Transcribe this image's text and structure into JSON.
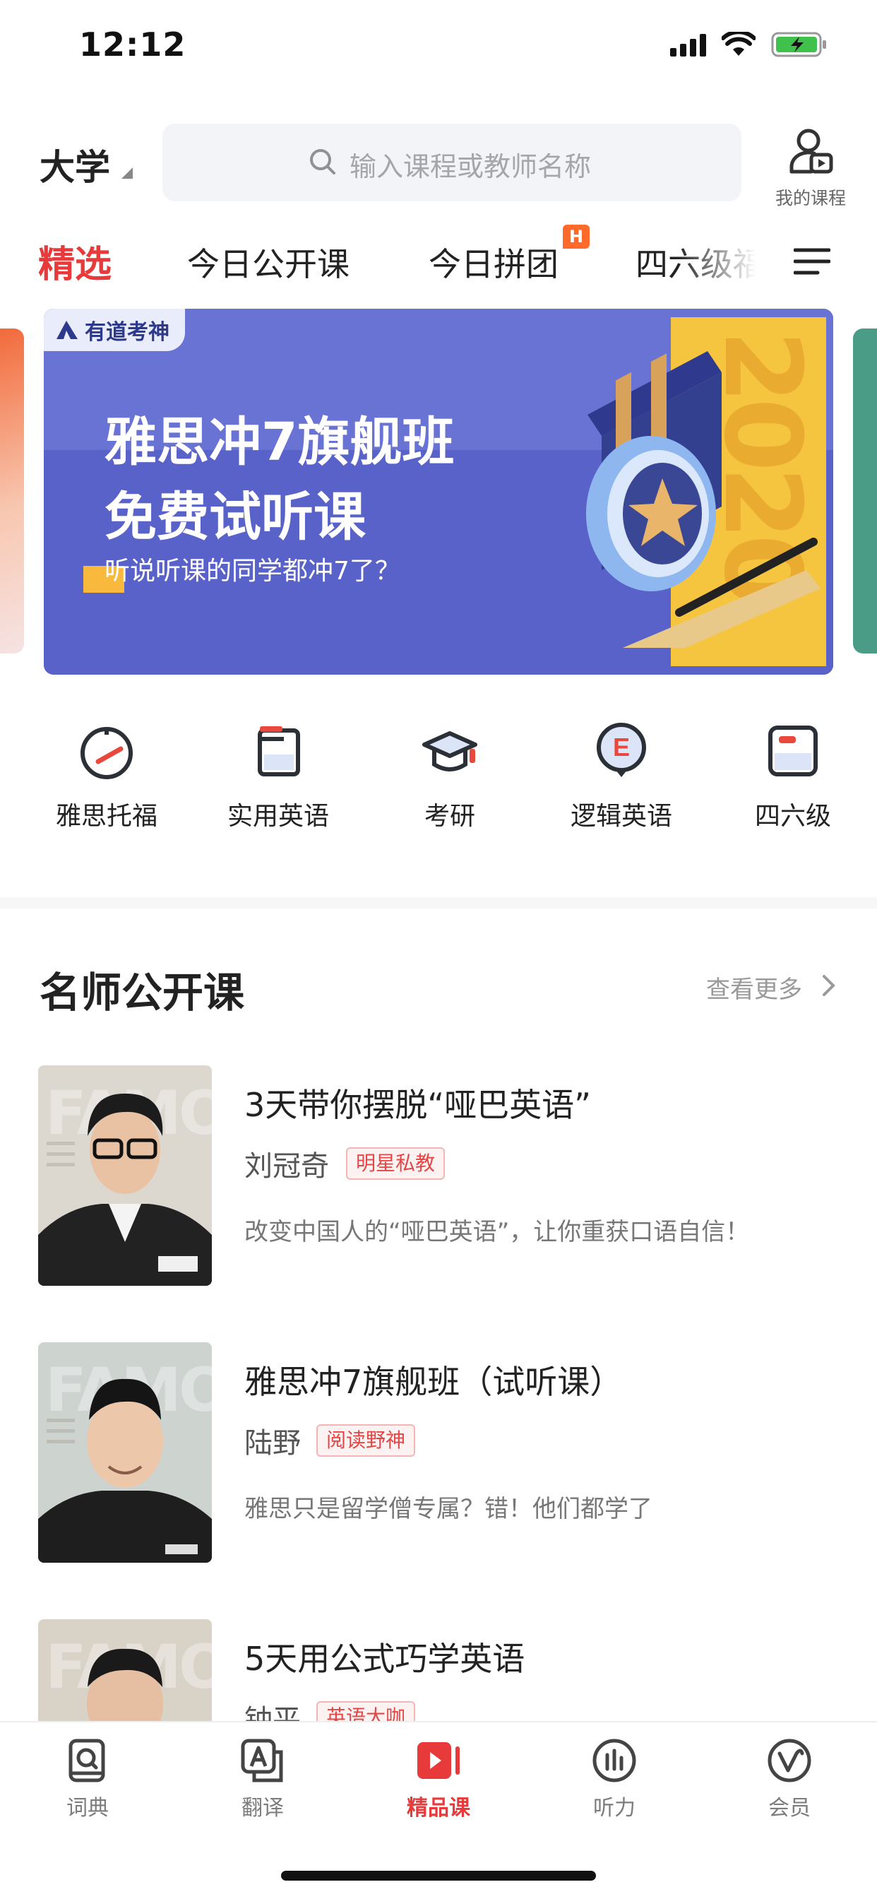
{
  "status_bar": {
    "time": "12:12"
  },
  "header": {
    "grade": "大学",
    "search_placeholder": "输入课程或教师名称",
    "my_courses": "我的课程"
  },
  "tabs": [
    {
      "label": "精选",
      "active": true
    },
    {
      "label": "今日公开课",
      "active": false
    },
    {
      "label": "今日拼团",
      "active": false,
      "badge": "H"
    },
    {
      "label": "四六级福",
      "active": false
    }
  ],
  "banner": {
    "brand": "有道考神",
    "title_line1": "雅思冲7旗舰班",
    "title_line2": "免费试听课",
    "subtitle": "听说听课的同学都冲7了？",
    "year": "2020"
  },
  "categories": [
    {
      "label": "雅思托福",
      "icon": "gauge-icon"
    },
    {
      "label": "实用英语",
      "icon": "book-icon"
    },
    {
      "label": "考研",
      "icon": "graduation-cap-icon"
    },
    {
      "label": "逻辑英语",
      "icon": "e-badge-icon"
    },
    {
      "label": "四六级",
      "icon": "notebook-icon"
    }
  ],
  "section": {
    "title": "名师公开课",
    "more": "查看更多"
  },
  "courses": [
    {
      "title": "3天带你摆脱“哑巴英语”",
      "teacher": "刘冠奇",
      "tag": "明星私教",
      "desc": "改变中国人的“哑巴英语”，让你重获口语自信！",
      "thumb_text": "FAMOUS"
    },
    {
      "title": "雅思冲7旗舰班（试听课）",
      "teacher": "陆野",
      "tag": "阅读野神",
      "desc": "雅思只是留学僧专属？错！他们都学了",
      "thumb_text": "FAMOUS"
    },
    {
      "title": "5天用公式巧学英语",
      "teacher": "钟平",
      "tag": "英语大咖",
      "desc": "",
      "thumb_text": "FAMOUS"
    }
  ],
  "tabbar": [
    {
      "label": "词典",
      "icon": "dictionary-icon",
      "active": false
    },
    {
      "label": "翻译",
      "icon": "translate-icon",
      "active": false
    },
    {
      "label": "精品课",
      "icon": "premium-course-icon",
      "active": true
    },
    {
      "label": "听力",
      "icon": "listening-icon",
      "active": false
    },
    {
      "label": "会员",
      "icon": "vip-icon",
      "active": false
    }
  ],
  "colors": {
    "accent": "#e83a3a",
    "banner": "#5862c8",
    "tag_bg": "#fdf2f2"
  }
}
